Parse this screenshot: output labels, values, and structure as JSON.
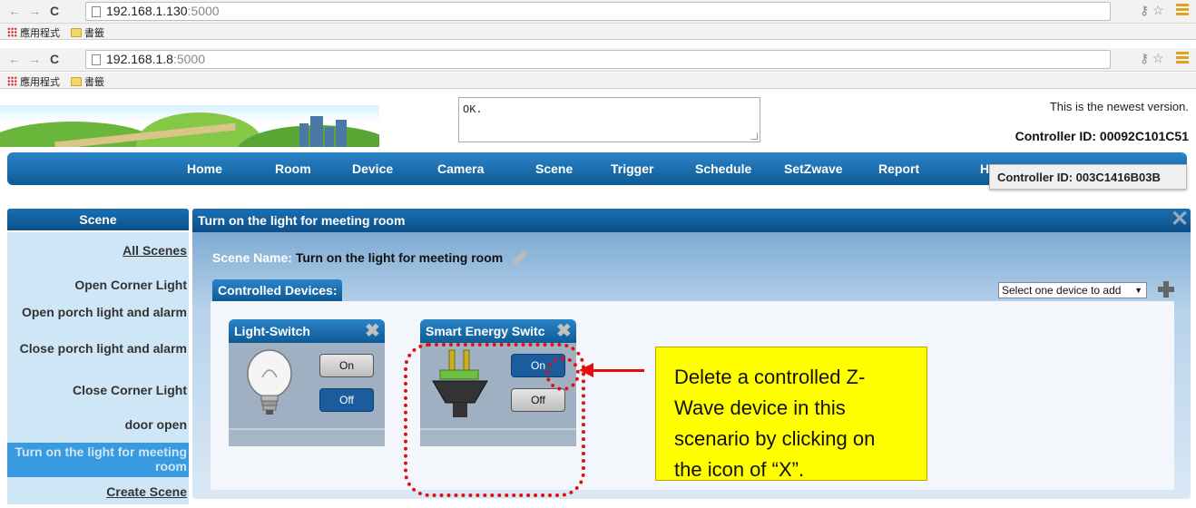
{
  "browser1": {
    "url_host": "192.168.1.130",
    "url_port": ":5000"
  },
  "browser2": {
    "url_host": "192.168.1.8",
    "url_port": ":5000"
  },
  "bookmarks": {
    "apps_label": "應用程式",
    "folder_label": "書籤"
  },
  "header": {
    "message": "OK.",
    "version_text": "This is the newest version.",
    "controller_id": "Controller ID: 00092C101C51",
    "controller_id_popup": "Controller ID: 003C1416B03B"
  },
  "nav": {
    "items": [
      "Home",
      "Room",
      "Device",
      "Camera",
      "Scene",
      "Trigger",
      "Schedule",
      "SetZwave",
      "Report",
      "H"
    ]
  },
  "sidebar": {
    "title": "Scene",
    "items": [
      {
        "label": "All Scenes"
      },
      {
        "label": "Open Corner Light"
      },
      {
        "label": "Open porch light and alarm"
      },
      {
        "label": "Close porch light and alarm"
      },
      {
        "label": "Close Corner Light"
      },
      {
        "label": "door open"
      },
      {
        "label": "Turn on the light for meeting room"
      },
      {
        "label": "Create Scene"
      }
    ]
  },
  "panel": {
    "title": "Turn on the light for meeting room",
    "scene_name_label": "Scene Name:",
    "scene_name_value": "Turn on the light for meeting room",
    "controlled_devices_label": "Controlled Devices:",
    "select_placeholder": "Select one device to add"
  },
  "devices": [
    {
      "name": "Light-Switch",
      "on_label": "On",
      "off_label": "Off",
      "state": "off",
      "icon": "light-bulb-icon"
    },
    {
      "name": "Smart Energy Switc",
      "on_label": "On",
      "off_label": "Off",
      "state": "on",
      "icon": "power-plug-icon"
    }
  ],
  "annotation": {
    "text": "Delete a controlled Z-Wave device in this scenario by clicking on the icon of “X”."
  },
  "colors": {
    "nav_blue": "#1a6fb2",
    "annotation_red": "#e01010",
    "callout_yellow": "#ffff00"
  }
}
